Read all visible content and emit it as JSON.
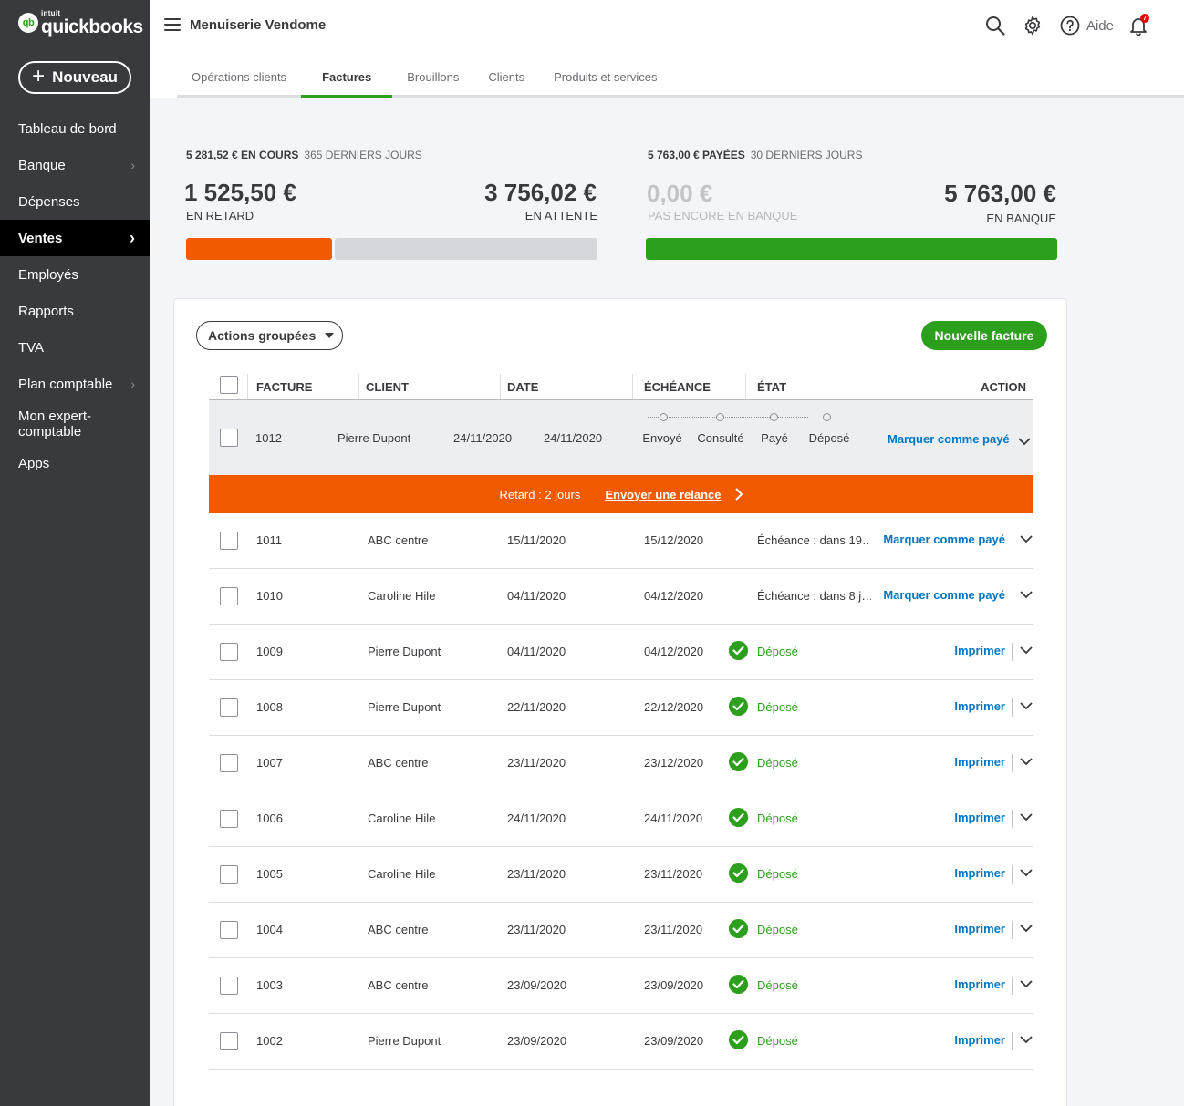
{
  "app": {
    "logo_brand": "intuit",
    "logo_name": "quickbooks",
    "logo_mark": "qb",
    "new_label": "Nouveau",
    "company": "Menuiserie Vendome",
    "help_label": "Aide",
    "notif_count": "7"
  },
  "sidebar": {
    "items": [
      {
        "label": "Tableau de bord",
        "chevron": false,
        "active": false
      },
      {
        "label": "Banque",
        "chevron": true,
        "active": false
      },
      {
        "label": "Dépenses",
        "chevron": false,
        "active": false
      },
      {
        "label": "Ventes",
        "chevron": true,
        "active": true
      },
      {
        "label": "Employés",
        "chevron": false,
        "active": false
      },
      {
        "label": "Rapports",
        "chevron": false,
        "active": false
      },
      {
        "label": "TVA",
        "chevron": false,
        "active": false
      },
      {
        "label": "Plan comptable",
        "chevron": true,
        "active": false
      },
      {
        "label": "Mon expert-comptable",
        "chevron": false,
        "active": false
      },
      {
        "label": "Apps",
        "chevron": false,
        "active": false
      }
    ]
  },
  "tabs": [
    {
      "label": "Opérations clients",
      "active": false
    },
    {
      "label": "Factures",
      "active": true
    },
    {
      "label": "Brouillons",
      "active": false
    },
    {
      "label": "Clients",
      "active": false
    },
    {
      "label": "Produits et services",
      "active": false
    }
  ],
  "summary": {
    "unpaid_head": "5 281,52 € EN COURS",
    "unpaid_period": "365 DERNIERS JOURS",
    "overdue_amount": "1 525,50 €",
    "overdue_label": "EN RETARD",
    "pending_amount": "3 756,02 €",
    "pending_label": "EN ATTENTE",
    "overdue_fraction": 0.289,
    "paid_head": "5 763,00 € PAYÉES",
    "paid_period": "30 DERNIERS JOURS",
    "not_deposited_amount": "0,00 €",
    "not_deposited_label": "PAS ENCORE EN BANQUE",
    "deposited_amount": "5 763,00 €",
    "deposited_label": "EN BANQUE",
    "colors": {
      "overdue": "#f25a00",
      "pending": "#d4d7dc",
      "deposited": "#2ca01c"
    }
  },
  "toolbar": {
    "batch_label": "Actions groupées",
    "new_invoice_label": "Nouvelle facture"
  },
  "table": {
    "headers": {
      "invoice": "FACTURE",
      "client": "CLIENT",
      "date": "DATE",
      "due": "ÉCHÉANCE",
      "status": "ÉTAT",
      "action": "ACTION"
    },
    "expanded_row": {
      "invoice": "1012",
      "client": "Pierre Dupont",
      "date": "24/11/2020",
      "due": "24/11/2020",
      "steps": [
        "Envoyé",
        "Consulté",
        "Payé",
        "Déposé"
      ],
      "action": "Marquer comme payé",
      "alert_text": "Retard : 2 jours",
      "alert_link": "Envoyer une relance"
    },
    "rows": [
      {
        "invoice": "1011",
        "client": "ABC centre",
        "date": "15/11/2020",
        "due": "15/12/2020",
        "status": "Échéance : dans 19…",
        "deposited": false,
        "action": "Marquer comme payé"
      },
      {
        "invoice": "1010",
        "client": "Caroline Hile",
        "date": "04/11/2020",
        "due": "04/12/2020",
        "status": "Échéance : dans 8 j…",
        "deposited": false,
        "action": "Marquer comme payé"
      },
      {
        "invoice": "1009",
        "client": "Pierre Dupont",
        "date": "04/11/2020",
        "due": "04/12/2020",
        "status": "Déposé",
        "deposited": true,
        "action": "Imprimer"
      },
      {
        "invoice": "1008",
        "client": "Pierre Dupont",
        "date": "22/11/2020",
        "due": "22/12/2020",
        "status": "Déposé",
        "deposited": true,
        "action": "Imprimer"
      },
      {
        "invoice": "1007",
        "client": "ABC centre",
        "date": "23/11/2020",
        "due": "23/12/2020",
        "status": "Déposé",
        "deposited": true,
        "action": "Imprimer"
      },
      {
        "invoice": "1006",
        "client": "Caroline Hile",
        "date": "24/11/2020",
        "due": "24/11/2020",
        "status": "Déposé",
        "deposited": true,
        "action": "Imprimer"
      },
      {
        "invoice": "1005",
        "client": "Caroline Hile",
        "date": "23/11/2020",
        "due": "23/11/2020",
        "status": "Déposé",
        "deposited": true,
        "action": "Imprimer"
      },
      {
        "invoice": "1004",
        "client": "ABC centre",
        "date": "23/11/2020",
        "due": "23/11/2020",
        "status": "Déposé",
        "deposited": true,
        "action": "Imprimer"
      },
      {
        "invoice": "1003",
        "client": "ABC centre",
        "date": "23/09/2020",
        "due": "23/09/2020",
        "status": "Déposé",
        "deposited": true,
        "action": "Imprimer"
      },
      {
        "invoice": "1002",
        "client": "Pierre Dupont",
        "date": "23/09/2020",
        "due": "23/09/2020",
        "status": "Déposé",
        "deposited": true,
        "action": "Imprimer"
      }
    ]
  },
  "icons": {
    "search": "search-icon",
    "settings": "gear-icon",
    "help": "help-circle-icon",
    "notifications": "bell-icon",
    "menu": "hamburger-icon",
    "expand": "chevron-down-icon",
    "deposited": "check-circle-icon"
  }
}
